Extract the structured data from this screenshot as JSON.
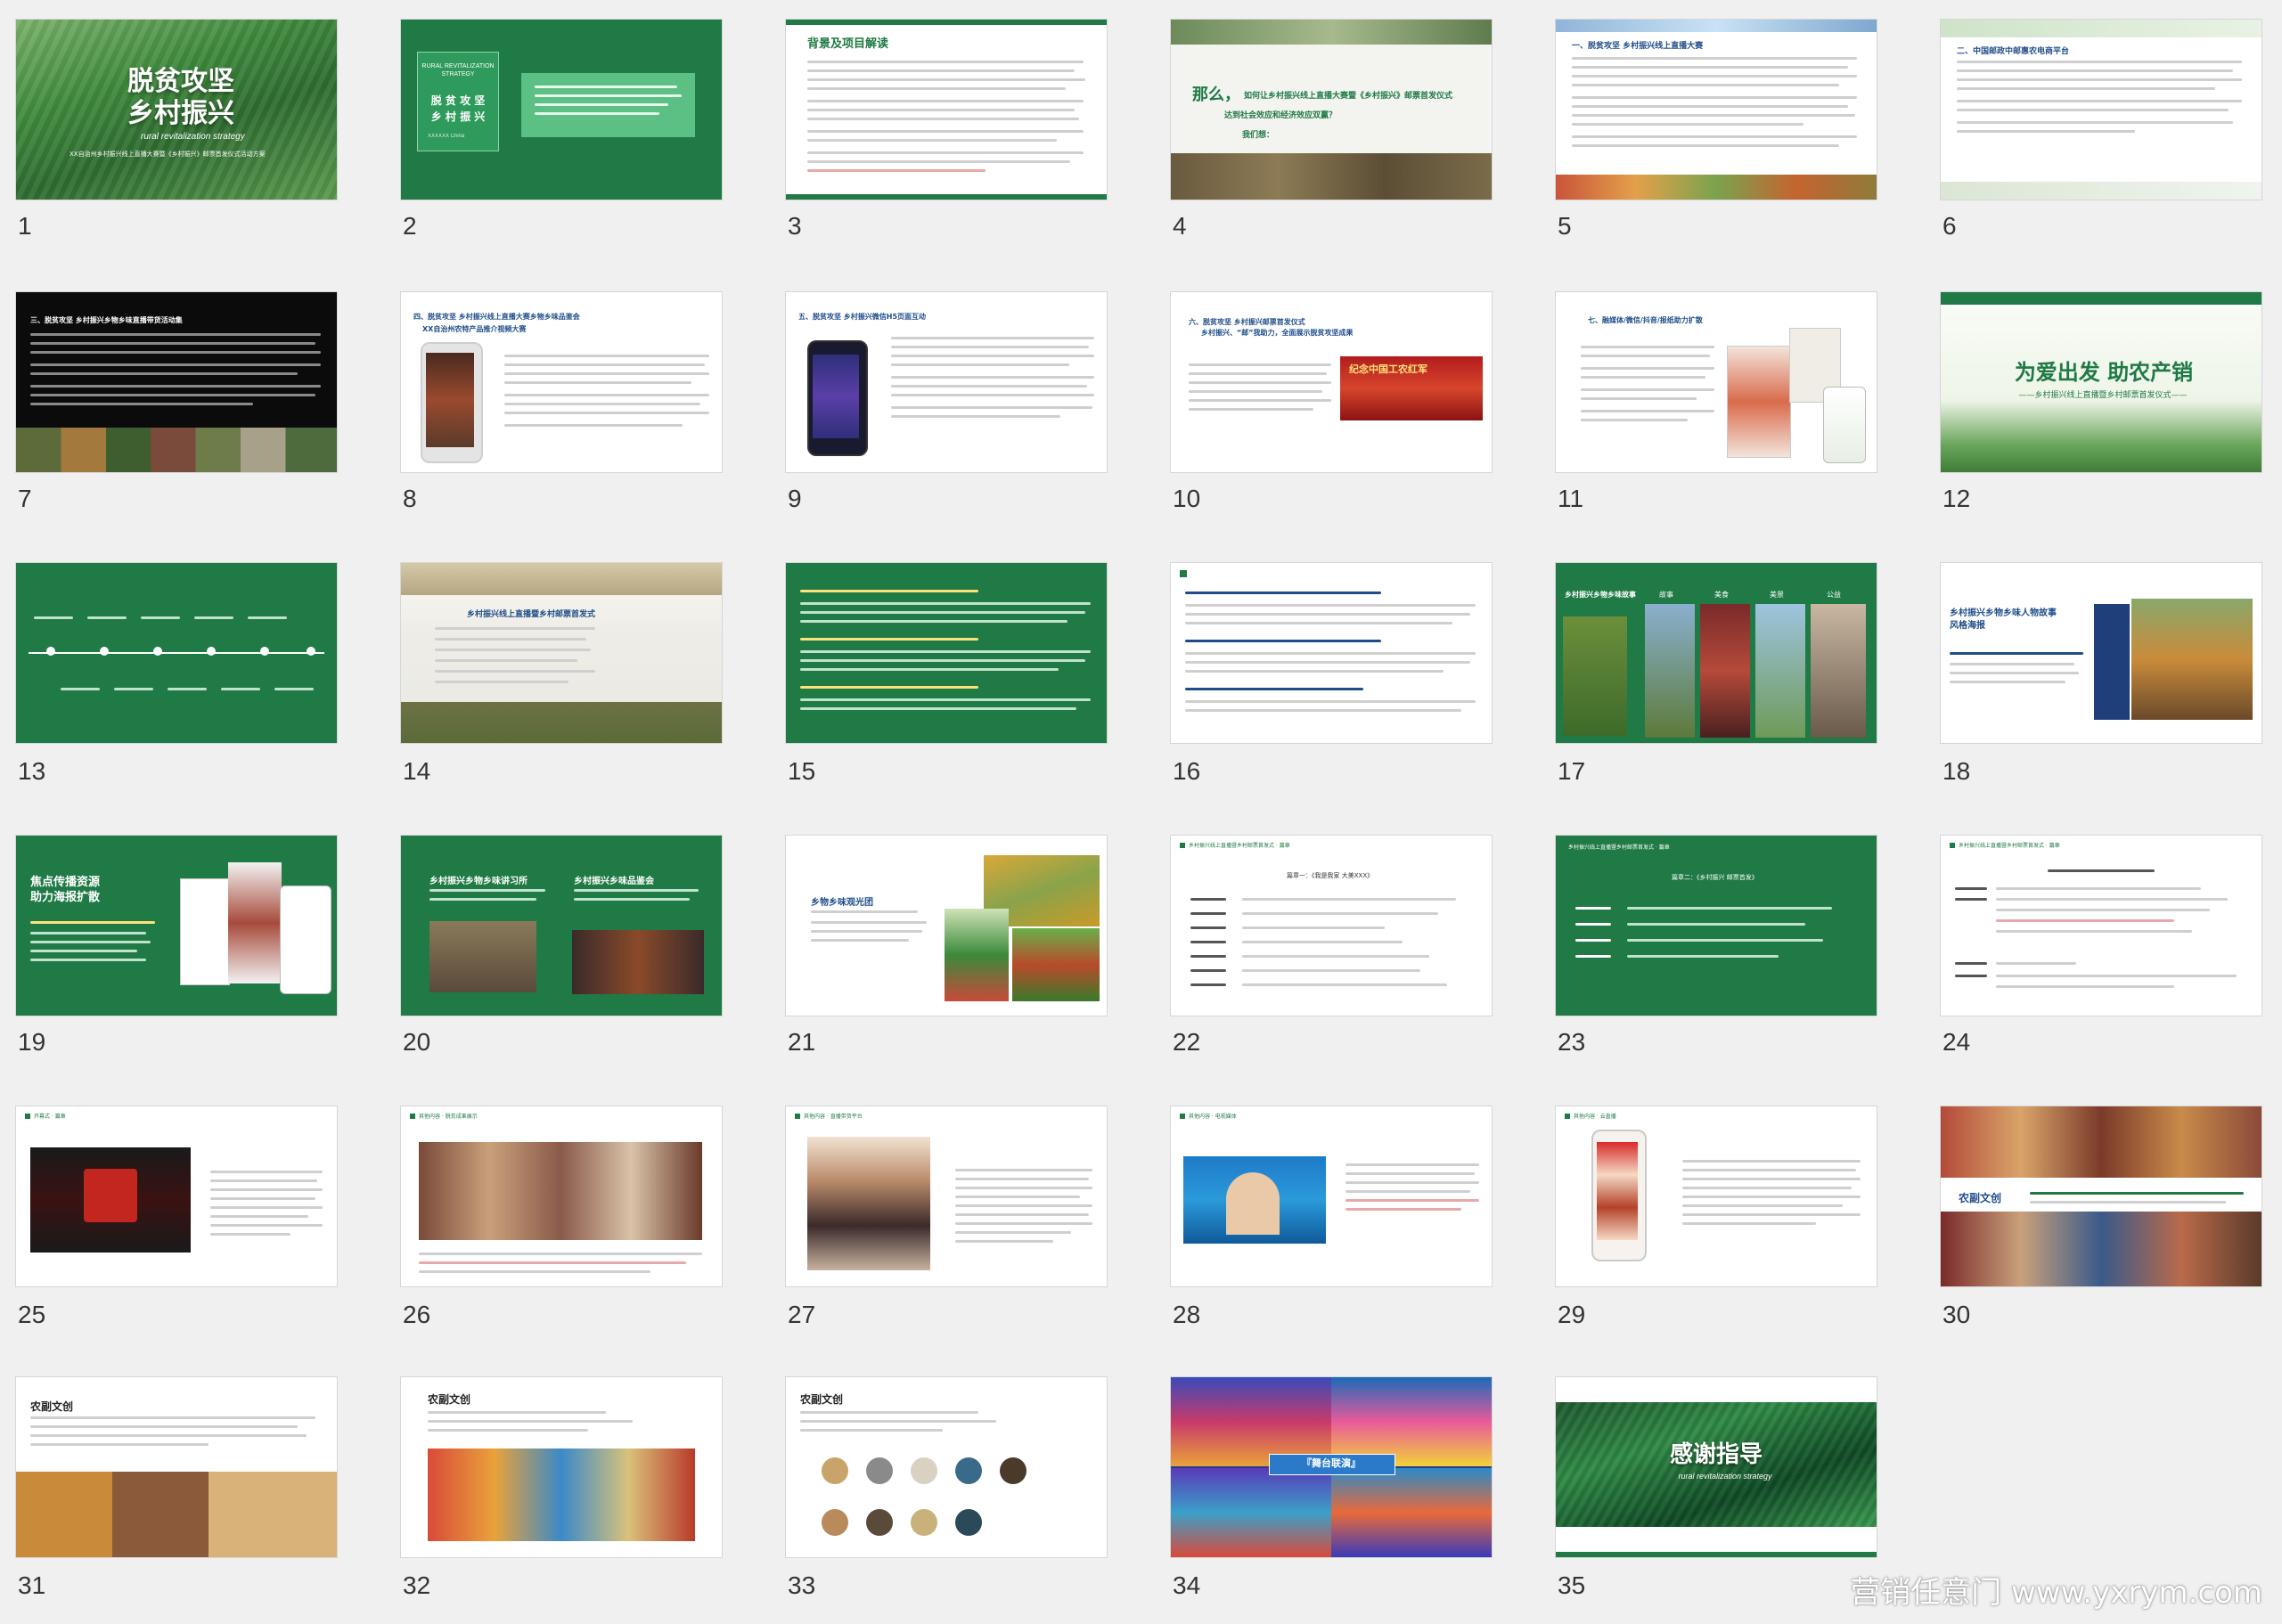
{
  "slides": [
    {
      "num": "1",
      "title": "脱贫攻坚\n乡村振兴",
      "subtitle": "rural revitalization strategy",
      "caption": "XX自治州乡村振兴线上直播大赛暨《乡村振兴》邮票首发仪式活动方案"
    },
    {
      "num": "2",
      "en": "RURAL REVITALIZATION STRATEGY",
      "title": "脱 贫 攻 坚\n乡 村 振 兴",
      "caption": "XXXXXX China"
    },
    {
      "num": "3",
      "title": "背景及项目解读"
    },
    {
      "num": "4",
      "lead": "那么，",
      "question": "如何让乡村振兴线上直播大赛暨《乡村振兴》邮票首发仪式",
      "question2": "达到社会效应和经济效应双赢？",
      "answer": "我们想："
    },
    {
      "num": "5",
      "heading": "一、脱贫攻坚 乡村振兴线上直播大赛"
    },
    {
      "num": "6",
      "heading": "二、中国邮政中邮惠农电商平台"
    },
    {
      "num": "7",
      "heading": "三、脱贫攻坚 乡村振兴乡物乡味直播带货活动集"
    },
    {
      "num": "8",
      "heading": "四、脱贫攻坚 乡村振兴线上直播大赛乡物乡味品鉴会",
      "heading2": "XX自治州农特产品推介视频大赛"
    },
    {
      "num": "9",
      "heading": "五、脱贫攻坚 乡村振兴微信H5页面互动"
    },
    {
      "num": "10",
      "heading": "六、脱贫攻坚 乡村振兴邮票首发仪式",
      "heading2": "乡村振兴、“邮”我助力，全面展示脱贫攻坚成果",
      "banner": "纪念中国工农红军"
    },
    {
      "num": "11",
      "heading": "七、融媒体/微信/抖音/报纸助力扩散"
    },
    {
      "num": "12",
      "title": "为爱出发 助农产销",
      "subtitle": "——乡村振兴线上直播暨乡村邮票首发仪式——"
    },
    {
      "num": "13"
    },
    {
      "num": "14",
      "title": "乡村振兴线上直播暨乡村邮票首发式"
    },
    {
      "num": "15"
    },
    {
      "num": "16"
    },
    {
      "num": "17",
      "title": "乡村振兴乡物乡味故事",
      "tags": [
        "故事",
        "美食",
        "美景",
        "公益"
      ]
    },
    {
      "num": "18",
      "title": "乡村振兴乡物乡味人物故事\n风格海报"
    },
    {
      "num": "19",
      "title": "焦点传播资源\n助力海报扩散"
    },
    {
      "num": "20",
      "title": "乡村振兴乡物乡味讲习所",
      "title2": "乡村振兴乡味品鉴会"
    },
    {
      "num": "21",
      "title": "乡物乡味观光团"
    },
    {
      "num": "22",
      "heading": "乡村振兴线上直播暨乡村邮票首发式 · 篇章",
      "sub": "篇章一：《我是我家 大美XXX》"
    },
    {
      "num": "23",
      "heading": "乡村振兴线上直播暨乡村邮票首发式 · 篇章",
      "sub": "篇章二：《乡村振兴 邮票首发》"
    },
    {
      "num": "24",
      "heading": "乡村振兴线上直播暨乡村邮票首发式 · 篇章"
    },
    {
      "num": "25",
      "heading": "开幕式 · 篇章"
    },
    {
      "num": "26",
      "heading": "其他内容 · 脱贫成果展示"
    },
    {
      "num": "27",
      "heading": "其他内容 · 直播带货平台"
    },
    {
      "num": "28",
      "heading": "其他内容 · 电视媒体"
    },
    {
      "num": "29",
      "heading": "其他内容 · 云直播"
    },
    {
      "num": "30",
      "title": "农副文创"
    },
    {
      "num": "31",
      "title": "农副文创"
    },
    {
      "num": "32",
      "title": "农副文创"
    },
    {
      "num": "33",
      "title": "农副文创"
    },
    {
      "num": "34",
      "banner": "『舞台联演』"
    },
    {
      "num": "35",
      "title": "感谢指导",
      "subtitle": "rural revitalization strategy"
    }
  ],
  "watermark": "营销任意门 www.yxrym.com",
  "colors": {
    "green": "#1f7a45",
    "dark_green": "#0f5a30",
    "bg": "#f0f0f0"
  }
}
